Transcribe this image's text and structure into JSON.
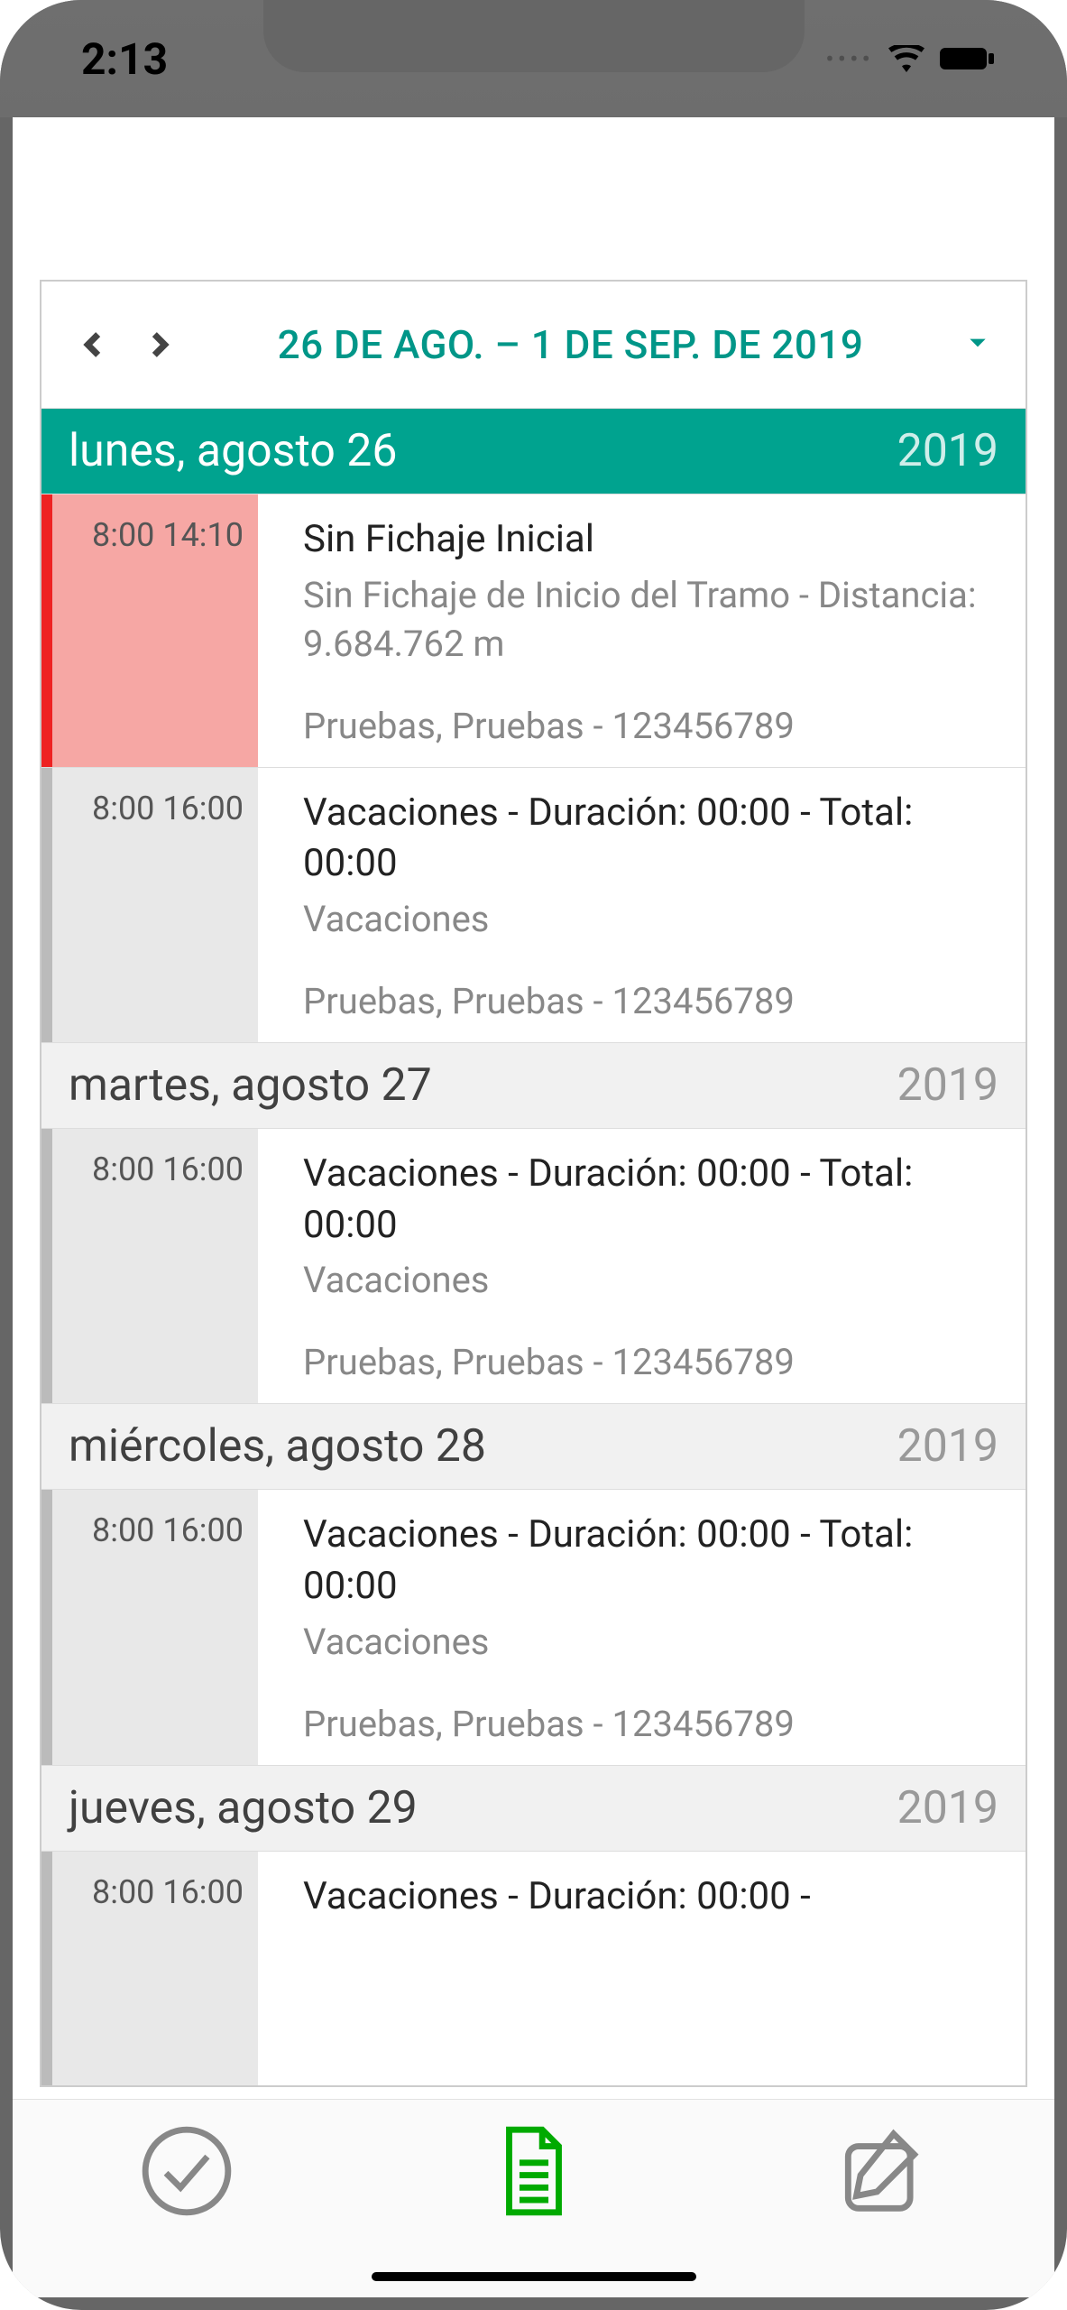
{
  "status": {
    "time": "2:13"
  },
  "range": {
    "label": "26 DE AGO. – 1 DE SEP. DE 2019"
  },
  "colors": {
    "accent": "#009688",
    "alert_stripe": "#e22",
    "alert_bg": "#f6a7a4"
  },
  "days": [
    {
      "name": "lunes, agosto 26",
      "year": "2019",
      "active": true,
      "entries": [
        {
          "alert": true,
          "time": "8:00 14:10",
          "title": "Sin Fichaje Inicial",
          "subtitle": "Sin Fichaje de Inicio del Tramo - Distancia: 9.684.762 m",
          "footer": "Pruebas, Pruebas - 123456789"
        },
        {
          "alert": false,
          "time": "8:00 16:00",
          "title": "Vacaciones - Duración: 00:00 - Total: 00:00",
          "subtitle": "Vacaciones",
          "footer": "Pruebas, Pruebas - 123456789"
        }
      ]
    },
    {
      "name": "martes, agosto 27",
      "year": "2019",
      "active": false,
      "entries": [
        {
          "alert": false,
          "time": "8:00 16:00",
          "title": "Vacaciones - Duración: 00:00 - Total: 00:00",
          "subtitle": "Vacaciones",
          "footer": "Pruebas, Pruebas - 123456789"
        }
      ]
    },
    {
      "name": "miércoles, agosto 28",
      "year": "2019",
      "active": false,
      "entries": [
        {
          "alert": false,
          "time": "8:00 16:00",
          "title": "Vacaciones - Duración: 00:00 - Total: 00:00",
          "subtitle": "Vacaciones",
          "footer": "Pruebas, Pruebas - 123456789"
        }
      ]
    },
    {
      "name": "jueves, agosto 29",
      "year": "2019",
      "active": false,
      "entries": [
        {
          "alert": false,
          "time": "8:00 16:00",
          "title": "Vacaciones - Duración: 00:00 -",
          "subtitle": "",
          "footer": ""
        }
      ]
    }
  ],
  "toolbar": {
    "items": [
      "approve",
      "document",
      "edit"
    ]
  }
}
